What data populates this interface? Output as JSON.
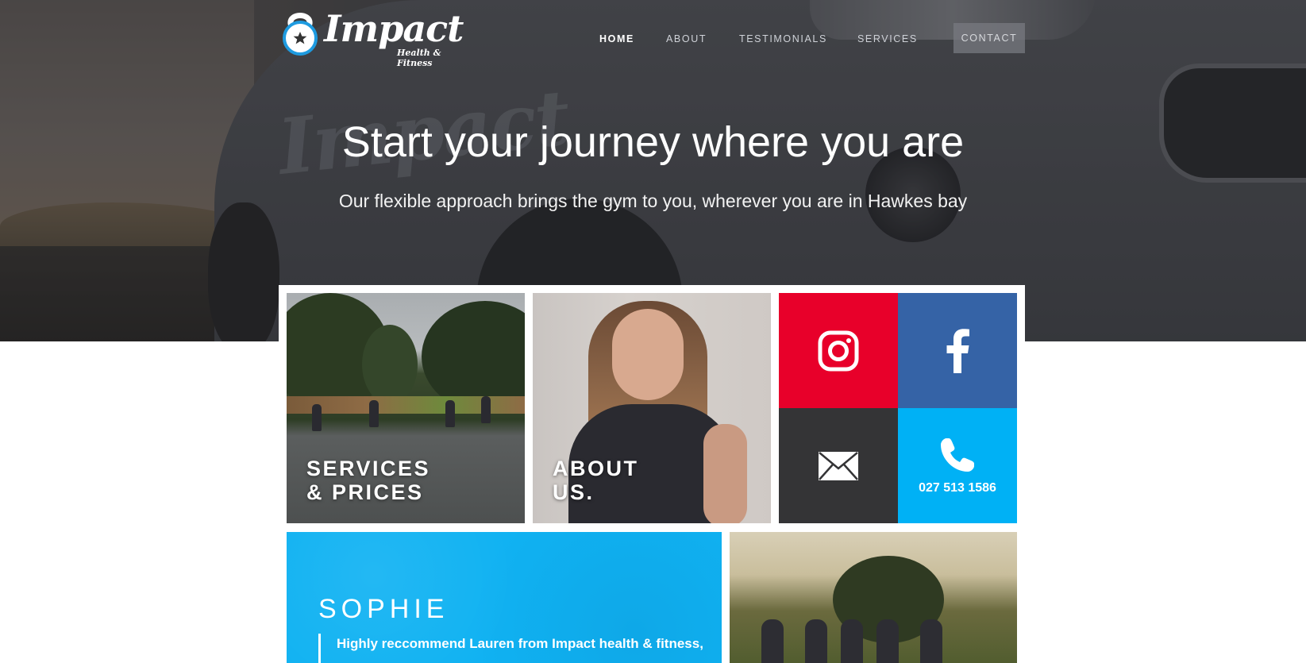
{
  "brand": {
    "logo_word": "Impact",
    "logo_sub": "Health & Fitness",
    "accent_color": "#00b1f5"
  },
  "nav": {
    "items": [
      "HOME",
      "ABOUT",
      "TESTIMONIALS",
      "SERVICES"
    ],
    "active": "HOME",
    "contact_label": "CONTACT"
  },
  "hero": {
    "headline": "Start your journey where you are",
    "subhead": "Our flexible approach brings the gym to you, wherever you are in Hawkes bay"
  },
  "tiles": {
    "services_caption": [
      "SERVICES",
      "& PRICES"
    ],
    "about_caption": [
      "ABOUT",
      "US."
    ]
  },
  "social": {
    "instagram_icon": "instagram-icon",
    "facebook_icon": "facebook-icon",
    "mail_icon": "mail-icon",
    "phone_icon": "phone-icon",
    "phone_number": "027 513 1586",
    "colors": {
      "instagram": "#e8002a",
      "facebook": "#3563a6",
      "mail": "#343436",
      "phone": "#00b1f5"
    }
  },
  "testimonial": {
    "name": "SOPHIE",
    "quote": "Highly reccommend Lauren from Impact health & fitness,"
  }
}
